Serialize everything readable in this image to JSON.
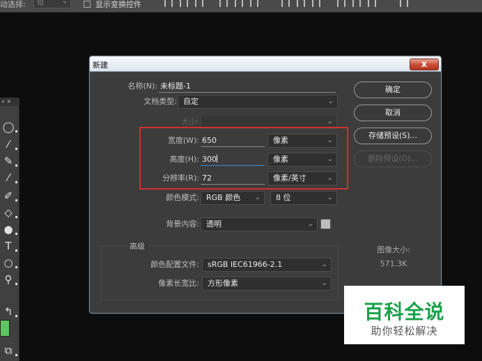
{
  "topbar": {
    "label": "动选择:",
    "select_value": "组",
    "checkbox_label": "显示变换控件"
  },
  "tools_panel": {
    "header": "« ×"
  },
  "dialog": {
    "title": "新建",
    "close_glyph": "x",
    "name_label": "名称(N):",
    "name_value": "未标题-1",
    "doc_type_label": "文档类型:",
    "doc_type_value": "自定",
    "size_label": "大小:",
    "width_label": "宽度(W):",
    "width_value": "650",
    "width_unit": "像素",
    "height_label": "高度(H):",
    "height_value": "300",
    "height_unit": "像素",
    "resolution_label": "分辨率(R):",
    "resolution_value": "72",
    "resolution_unit": "像素/英寸",
    "color_mode_label": "颜色模式:",
    "color_mode_value": "RGB 颜色",
    "bit_depth_value": "8 位",
    "background_label": "背景内容:",
    "background_value": "透明",
    "advanced_label": "高级",
    "profile_label": "颜色配置文件:",
    "profile_value": "sRGB IEC61966-2.1",
    "pixel_aspect_label": "像素长宽比:",
    "pixel_aspect_value": "方形像素",
    "buttons": {
      "ok": "确定",
      "cancel": "取消",
      "save_preset": "存储预设(S)...",
      "delete_preset": "删除预设(D)..."
    },
    "image_size_label": "图像大小:",
    "image_size_value": "571.3K"
  },
  "watermark": {
    "title": "百科全说",
    "subtitle": "助你轻松解决"
  },
  "colors": {
    "highlight_box": "#d32f2f",
    "watermark_green": "#1aa14a",
    "foreground_swatch": "#62c462"
  }
}
